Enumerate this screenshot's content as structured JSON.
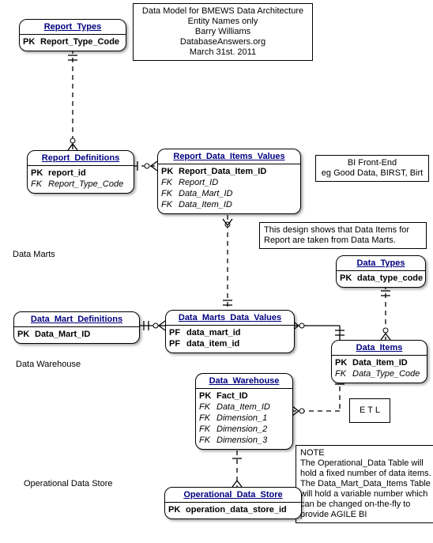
{
  "header": {
    "line1": "Data Model for BMEWS Data Architecture",
    "line2": "Entity Names only",
    "line3": "Barry Williams",
    "line4": "DatabaseAnswers.org",
    "line5": "March 31st. 2011"
  },
  "entities": {
    "report_types": {
      "title": "Report_Types",
      "rows": [
        {
          "k": "PK",
          "a": "Report_Type_Code"
        }
      ]
    },
    "report_definitions": {
      "title": "Report_Definitions",
      "rows": [
        {
          "k": "PK",
          "a": "report_id"
        },
        {
          "k": "FK",
          "a": "Report_Type_Code",
          "fk": true
        }
      ]
    },
    "report_data_items_values": {
      "title": "Report_Data_Items_Values",
      "rows": [
        {
          "k": "PK",
          "a": "Report_Data_Item_ID"
        },
        {
          "k": "FK",
          "a": "Report_ID",
          "fk": true
        },
        {
          "k": "FK",
          "a": "Data_Mart_ID",
          "fk": true
        },
        {
          "k": "FK",
          "a": "Data_Item_ID",
          "fk": true
        }
      ]
    },
    "data_types": {
      "title": "Data_Types",
      "rows": [
        {
          "k": "PK",
          "a": "data_type_code"
        }
      ]
    },
    "data_mart_definitions": {
      "title": "Data_Mart_Definitions",
      "rows": [
        {
          "k": "PK",
          "a": "Data_Mart_ID"
        }
      ]
    },
    "data_marts_data_values": {
      "title": "Data_Marts_Data_Values",
      "rows": [
        {
          "k": "PF",
          "a": "data_mart_id"
        },
        {
          "k": "PF",
          "a": "data_item_id"
        }
      ]
    },
    "data_items": {
      "title": "Data_Items",
      "rows": [
        {
          "k": "PK",
          "a": "Data_Item_ID"
        },
        {
          "k": "FK",
          "a": "Data_Type_Code",
          "fk": true
        }
      ]
    },
    "data_warehouse": {
      "title": "Data_Warehouse",
      "rows": [
        {
          "k": "PK",
          "a": "Fact_ID"
        },
        {
          "k": "FK",
          "a": "Data_Item_ID",
          "fk": true
        },
        {
          "k": "FK",
          "a": "Dimension_1",
          "fk": true
        },
        {
          "k": "FK",
          "a": "Dimension_2",
          "fk": true
        },
        {
          "k": "FK",
          "a": "Dimension_3",
          "fk": true
        }
      ]
    },
    "operational_data_store": {
      "title": "Operational_Data_Store",
      "rows": [
        {
          "k": "PK",
          "a": "operation_data_store_id"
        }
      ]
    }
  },
  "annotations": {
    "bi_frontend": {
      "line1": "BI Front-End",
      "line2": "eg Good Data, BIRST, Birt"
    },
    "design_note": "This design shows that Data Items for Report are taken from Data Marts.",
    "etl": "E T L",
    "note": {
      "title": "NOTE",
      "body": "The Operational_Data Table will hold a fixed number of data items. The Data_Mart_Data_Items Table will hold a variable number which can be changed on-the-fly to provide AGILE BI"
    }
  },
  "section_labels": {
    "data_marts": "Data Marts",
    "data_warehouse": "Data Warehouse",
    "operational_data_store": "Operational Data Store"
  }
}
